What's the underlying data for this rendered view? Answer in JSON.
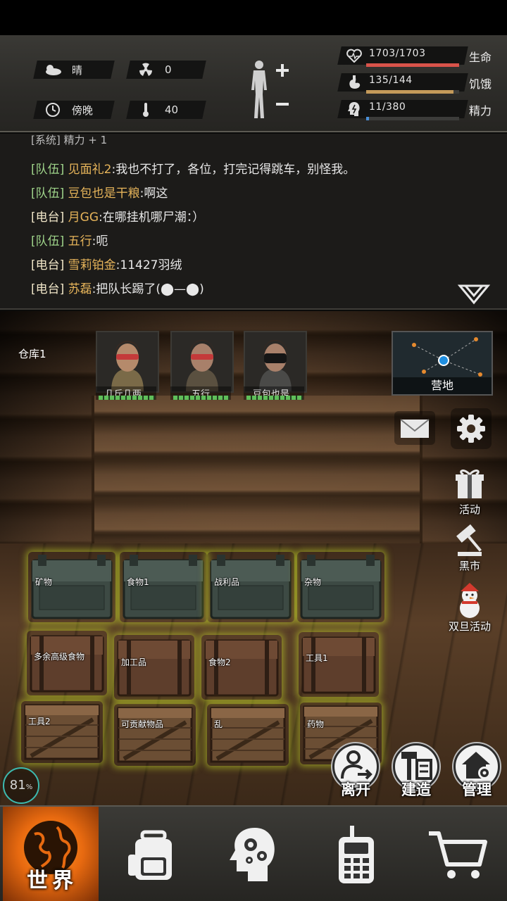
{
  "header": {
    "weather": {
      "icon": "cloudy-icon",
      "label": "晴"
    },
    "radiation": {
      "icon": "radiation-icon",
      "value": "0"
    },
    "time": {
      "icon": "clock-icon",
      "label": "傍晚"
    },
    "temperature": {
      "icon": "thermometer-icon",
      "value": "40"
    },
    "body_icon": "body-status-icon",
    "stats": [
      {
        "key": "health",
        "icon": "heart-icon",
        "value": "1703/1703",
        "label": "生命",
        "fraction": 1.0,
        "color": "#d9534a"
      },
      {
        "key": "hunger",
        "icon": "stomach-icon",
        "value": "135/144",
        "label": "饥饿",
        "fraction": 0.9375,
        "color": "#c49a5a"
      },
      {
        "key": "energy",
        "icon": "brain-icon",
        "value": "11/380",
        "label": "精力",
        "fraction": 0.029,
        "color": "#4a90d9"
      }
    ]
  },
  "chat": {
    "partial_line": "[系统] 精力 + 1",
    "lines": [
      {
        "channel": "[队伍]",
        "name": "见面礼2",
        "message": ":我也不打了，各位，打完记得跳车，别怪我。",
        "type": "team"
      },
      {
        "channel": "[队伍]",
        "name": "豆包也是干粮",
        "message": ":啊这",
        "type": "team"
      },
      {
        "channel": "[电台]",
        "name": "月GG",
        "message": ":在哪挂机哪尸潮：）",
        "type": "radio"
      },
      {
        "channel": "[队伍]",
        "name": "五行",
        "message": ":呃",
        "type": "team"
      },
      {
        "channel": "[电台]",
        "name": "雪莉铂金",
        "message": ":11427羽绒",
        "type": "radio"
      },
      {
        "channel": "[电台]",
        "name": "苏磊",
        "message": ":把队长踢了(⬤—⬤)",
        "type": "radio"
      }
    ]
  },
  "scene": {
    "warehouse_label": "仓库1",
    "members": [
      {
        "name": "几斤几两..",
        "hp": 1.0
      },
      {
        "name": "五行",
        "hp": 1.0
      },
      {
        "name": "豆包也是..",
        "hp": 1.0
      }
    ],
    "camp_label": "营地",
    "side_buttons": {
      "event": "活动",
      "black_market": "黑市",
      "new_year_event": "双旦活动"
    },
    "crates_metal": [
      "矿物",
      "食物1",
      "战利品",
      "杂物"
    ],
    "crates_wood": [
      "多余高级食物",
      "加工品",
      "食物2",
      "工具1"
    ],
    "crates_plank": [
      "工具2",
      "可贡献物品",
      "乱",
      "药物"
    ],
    "actions": {
      "leave": "离开",
      "build": "建造",
      "manage": "管理"
    },
    "fps": "81",
    "fps_unit": "%"
  },
  "nav": {
    "world": "世界",
    "items": [
      "backpack-icon",
      "skills-icon",
      "radio-icon",
      "cart-icon"
    ]
  }
}
